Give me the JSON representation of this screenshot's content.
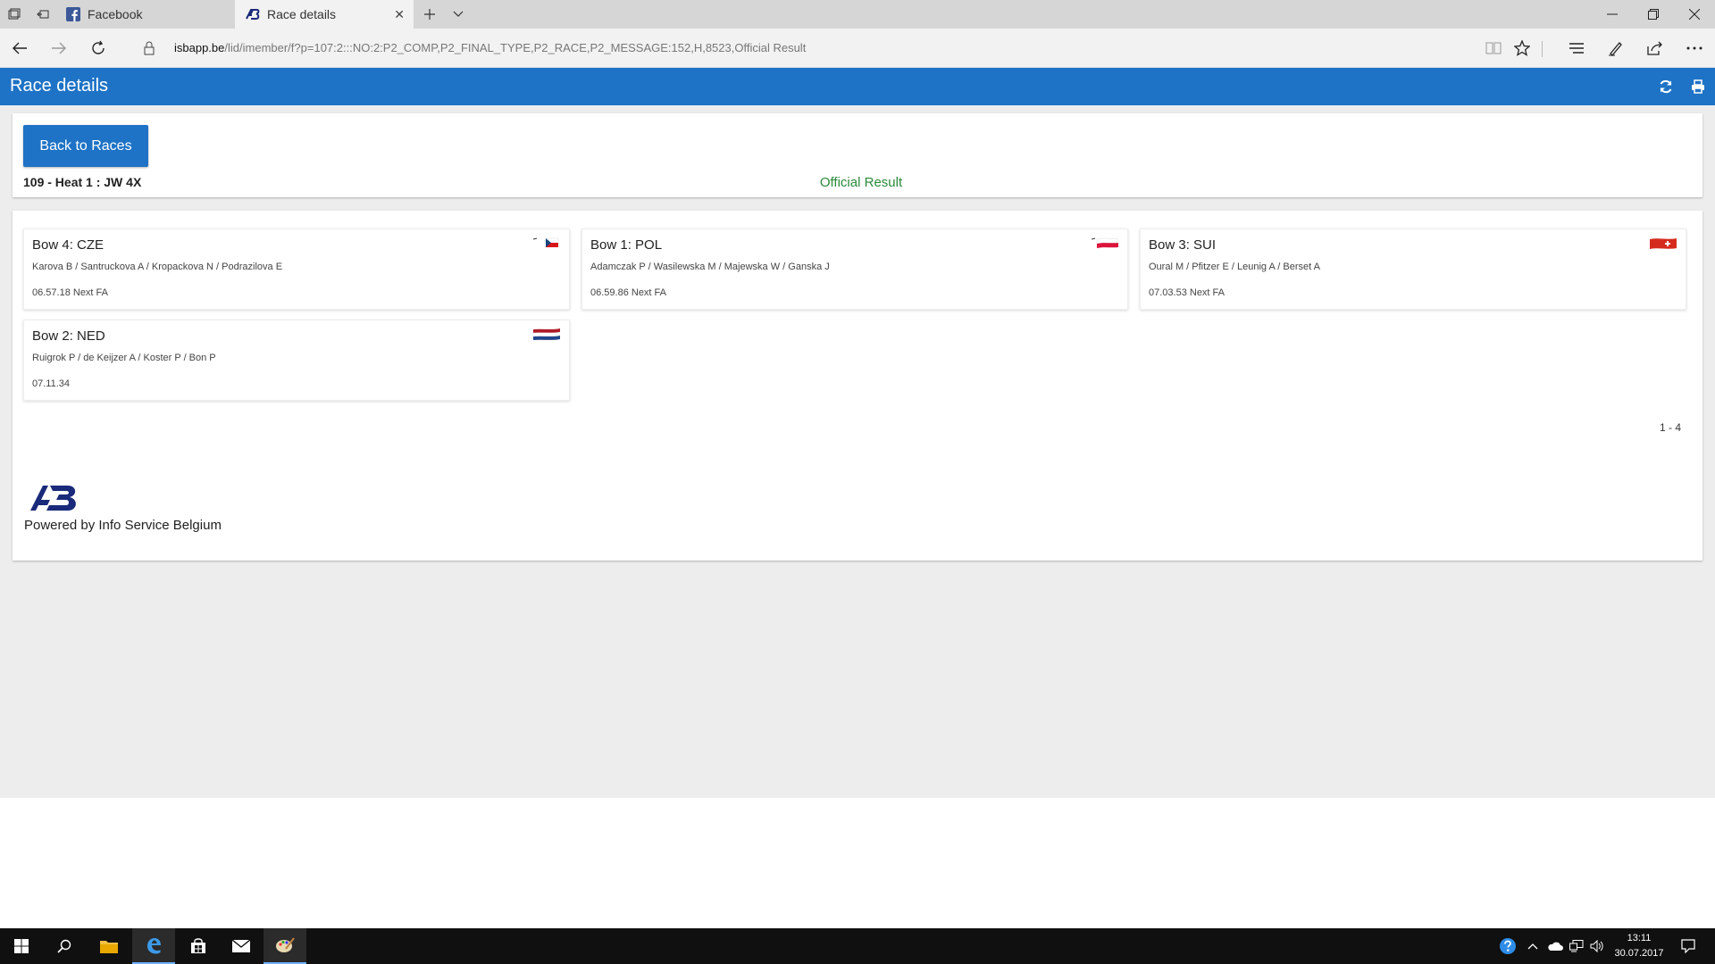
{
  "browser": {
    "tabs": [
      {
        "label": "Facebook",
        "icon": "facebook-icon"
      },
      {
        "label": "Race details",
        "icon": "isb-icon"
      }
    ],
    "url_host": "isbapp.be",
    "url_path": "/lid/imember/f?p=107:2:::NO:2:P2_COMP,P2_FINAL_TYPE,P2_RACE,P2_MESSAGE:152,H,8523,Official Result"
  },
  "page": {
    "header_title": "Race details",
    "back_button": "Back to Races",
    "race_title": "109 - Heat 1 : JW 4X",
    "status": "Official Result",
    "status_color": "#2a8a3a",
    "accent_color": "#1e73c6",
    "pager": "1 - 4",
    "powered_by": "Powered by Info Service Belgium"
  },
  "crews": [
    {
      "bow": "Bow 4: CZE",
      "crew": "Karova B / Santruckova A / Kropackova N / Podrazilova E",
      "result": "06.57.18 Next FA",
      "flag": "cze-flag-icon"
    },
    {
      "bow": "Bow 1: POL",
      "crew": "Adamczak P / Wasilewska M / Majewska W / Ganska J",
      "result": "06.59.86 Next FA",
      "flag": "pol-flag-icon"
    },
    {
      "bow": "Bow 3: SUI",
      "crew": "Oural M / Pfitzer E / Leunig A / Berset A",
      "result": "07.03.53 Next FA",
      "flag": "sui-flag-icon"
    },
    {
      "bow": "Bow 2: NED",
      "crew": "Ruigrok P / de Keijzer A / Koster P / Bon P",
      "result": "07.11.34",
      "flag": "ned-flag-icon"
    }
  ],
  "taskbar": {
    "time": "13:11",
    "date": "30.07.2017"
  }
}
